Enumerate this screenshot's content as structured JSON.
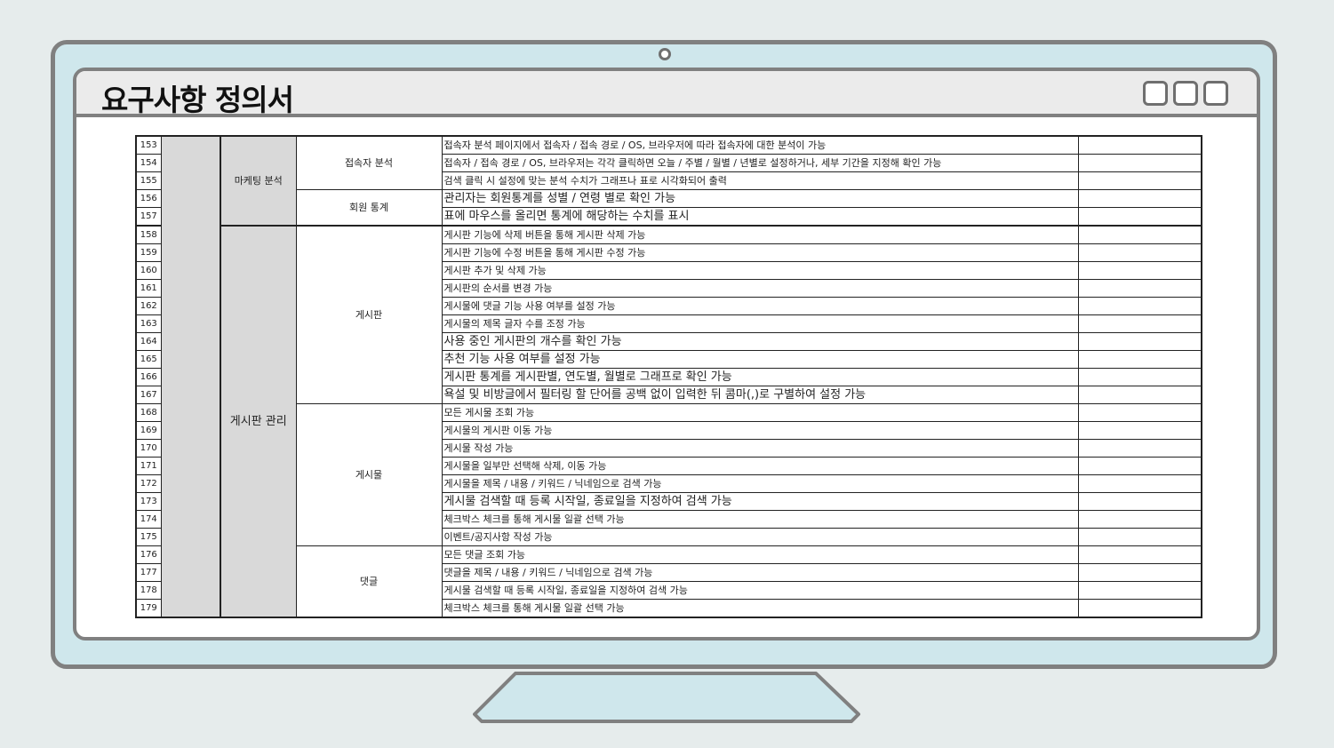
{
  "title": "요구사항 정의서",
  "rows": [
    {
      "no": "153",
      "desc": "접속자 분석 페이지에서 접속자 / 접속 경로 / OS, 브라우저에 따라 접속자에 대한 분석이 가능"
    },
    {
      "no": "154",
      "desc": "접속자 / 접속 경로 / OS, 브라우저는 각각 클릭하면 오늘 / 주별 / 월별 / 년별로 설정하거나, 세부 기간을 지정해 확인 가능"
    },
    {
      "no": "155",
      "desc": "검색 클릭 시 설정에 맞는 분석 수치가 그래프나 표로 시각화되어 출력"
    },
    {
      "no": "156",
      "desc": "관리자는 회원통계를 성별 / 연령 별로 확인 가능"
    },
    {
      "no": "157",
      "desc": "표에 마우스를 올리면 통계에 해당하는 수치를 표시"
    },
    {
      "no": "158",
      "desc": "게시판 기능에 삭제 버튼을 통해 게시판 삭제 가능"
    },
    {
      "no": "159",
      "desc": "게시판 기능에 수정 버튼을 통해 게시판 수정 가능"
    },
    {
      "no": "160",
      "desc": "게시판 추가 및 삭제 가능"
    },
    {
      "no": "161",
      "desc": "게시판의 순서를 변경 가능"
    },
    {
      "no": "162",
      "desc": "게시물에 댓글 기능 사용 여부를 설정 가능"
    },
    {
      "no": "163",
      "desc": "게시물의 제목 글자 수를 조정 가능"
    },
    {
      "no": "164",
      "desc": "사용 중인 게시판의 개수를 확인 가능"
    },
    {
      "no": "165",
      "desc": "추천 기능 사용 여부를 설정 가능"
    },
    {
      "no": "166",
      "desc": "게시판 통계를 게시판별, 연도별, 월별로 그래프로 확인 가능"
    },
    {
      "no": "167",
      "desc": "욕설 및 비방글에서 필터링 할 단어를 공백 없이 입력한 뒤 콤마(,)로 구별하여 설정 가능"
    },
    {
      "no": "168",
      "desc": "모든 게시물 조회 가능"
    },
    {
      "no": "169",
      "desc": "게시물의 게시판 이동 가능"
    },
    {
      "no": "170",
      "desc": "게시물 작성 가능"
    },
    {
      "no": "171",
      "desc": "게시물을 일부만 선택해 삭제, 이동 가능"
    },
    {
      "no": "172",
      "desc": "게시물을 제목 / 내용 / 키워드 / 닉네임으로 검색 가능"
    },
    {
      "no": "173",
      "desc": "게시물 검색할 때 등록 시작일, 종료일을 지정하여 검색 가능"
    },
    {
      "no": "174",
      "desc": "체크박스 체크를 통해 게시물 일괄 선택 가능"
    },
    {
      "no": "175",
      "desc": "이벤트/공지사항 작성 가능"
    },
    {
      "no": "176",
      "desc": "모든 댓글 조회 가능"
    },
    {
      "no": "177",
      "desc": "댓글을 제목 / 내용 / 키워드 / 닉네임으로 검색 가능"
    },
    {
      "no": "178",
      "desc": "게시물 검색할 때 등록 시작일, 종료일을 지정하여 검색 가능"
    },
    {
      "no": "179",
      "desc": "체크박스 체크를 통해 게시물 일괄 선택 가능"
    }
  ],
  "groups": {
    "marketing": "마케팅 분석",
    "board_mgmt": "게시판 관리",
    "visitor": "접속자 분석",
    "member_stats": "회원 통계",
    "board": "게시판",
    "post": "게시물",
    "comment": "댓글"
  }
}
